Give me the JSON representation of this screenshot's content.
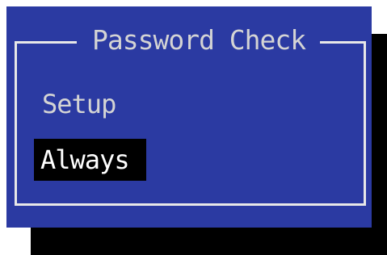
{
  "dialog": {
    "title": "Password Check",
    "options": [
      {
        "label": "Setup",
        "selected": false
      },
      {
        "label": "Always",
        "selected": true
      }
    ]
  },
  "colors": {
    "dialog_bg": "#2b3aa2",
    "frame": "#e8e8e8",
    "text": "#d4d4d4",
    "selection_bg": "#000000",
    "selection_text": "#ffffff",
    "shadow": "#000000"
  }
}
